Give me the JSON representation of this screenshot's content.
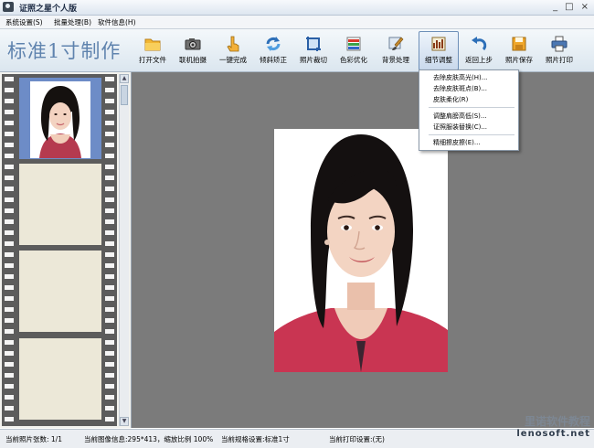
{
  "window": {
    "title": "证照之星个人版",
    "icon": "camera-icon",
    "controls": [
      "_",
      "□",
      "×"
    ]
  },
  "menu": [
    "系统设置(S)",
    "批量处理(B)",
    "软件信息(H)"
  ],
  "toolbar": {
    "brand_text": "标准1寸制作",
    "tools": [
      {
        "label": "打开文件",
        "icon": "folder-icon"
      },
      {
        "label": "联机拍摄",
        "icon": "camera-icon"
      },
      {
        "label": "一键完成",
        "icon": "hand-pointer-icon"
      },
      {
        "label": "倾斜矫正",
        "icon": "rotate-icon"
      },
      {
        "label": "照片裁切",
        "icon": "crop-icon"
      },
      {
        "label": "色彩优化",
        "icon": "color-bars-icon"
      },
      {
        "label": "背景处理",
        "icon": "brush-icon"
      },
      {
        "label": "细节调整",
        "icon": "detail-adjust-icon"
      },
      {
        "label": "返回上步",
        "icon": "undo-icon"
      },
      {
        "label": "照片保存",
        "icon": "save-icon"
      },
      {
        "label": "照片打印",
        "icon": "printer-icon"
      }
    ],
    "active_index": 7
  },
  "detail_menu": {
    "items": [
      "去除皮肤高光(H)...",
      "去除皮肤斑点(B)...",
      "皮肤柔化(R)",
      "调整肩膀高低(S)...",
      "证照服装替换(C)...",
      "精细擦皮擦(E)..."
    ]
  },
  "status": {
    "photo_count": "当前照片张数:  1/1",
    "image_info": "当前图像信息:295*413，缩放比例 100%",
    "spec": "当前规格设置:标准1寸",
    "print_setting": "当前打印设置:(无)"
  },
  "watermark": {
    "line1": "里诺软件教程",
    "line2": "lenosoft.net"
  },
  "colors": {
    "brand": "#5f83ae",
    "workspace": "#7b7b7b",
    "film": "#5c5c5c",
    "selected_frame": "#6d8cc7",
    "empty_frame": "#ece8d8"
  }
}
